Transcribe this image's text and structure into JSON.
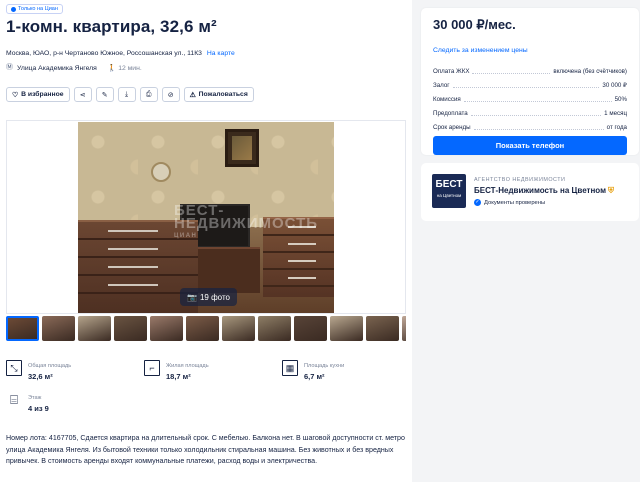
{
  "badge": "Только на Циан",
  "title": "1-комн. квартира, 32,6 м²",
  "address": {
    "text": "Москва, ЮАО, р-н Чертаново Южное, Россошанская ул., 11К3",
    "map_link": "На карте"
  },
  "metro": {
    "name": "Улица Академика Янгеля",
    "walk": "12 мин."
  },
  "actions": {
    "favorite": "В избранное",
    "report": "Пожаловаться",
    "icons": [
      "share-icon",
      "edit-icon",
      "download-icon",
      "print-icon",
      "hide-icon"
    ]
  },
  "gallery": {
    "photo_count": "19 фото",
    "watermark": "БЕСТ-НЕДВИЖИМОСТЬ",
    "watermark_small": "ЦИАН",
    "thumbnails": [
      "#6c4a36",
      "#8a6a58",
      "#b5a48c",
      "#6a5442",
      "#9a7a6a",
      "#7c5c48",
      "#a8987e",
      "#8e7e66",
      "#584438",
      "#b9a890",
      "#7a6450",
      "#c0a898"
    ]
  },
  "features": [
    {
      "label": "Общая площадь",
      "value": "32,6 м²",
      "icon": "total-area-icon"
    },
    {
      "label": "Жилая площадь",
      "value": "18,7 м²",
      "icon": "living-area-icon"
    },
    {
      "label": "Площадь кухни",
      "value": "6,7 м²",
      "icon": "kitchen-area-icon"
    },
    {
      "label": "Этаж",
      "value": "4 из 9",
      "icon": "floor-icon"
    }
  ],
  "description": "Номер лота: 4167705, Сдается квартира на длительный срок. С мебелью. Балкона нет. В шаговой доступности ст. метро улица Академика Янгеля. Из бытовой техники только холодильник стиральная машина. Без животных и без вредных привычек. В стоимость аренды входят коммунальные платежи, расход воды и электричества.",
  "price_card": {
    "price": "30 000 ₽/мес.",
    "watch_link": "Следить за изменением цены",
    "rows": [
      {
        "key": "Оплата ЖКХ",
        "value": "включена (без счётчиков)"
      },
      {
        "key": "Залог",
        "value": "30 000 ₽"
      },
      {
        "key": "Комиссия",
        "value": "50%"
      },
      {
        "key": "Предоплата",
        "value": "1 месяц"
      },
      {
        "key": "Срок аренды",
        "value": "от года"
      }
    ],
    "phone_button": "Показать телефон"
  },
  "agency": {
    "kind": "АГЕНТСТВО НЕДВИЖИМОСТИ",
    "name": "БЕСТ-Недвижимость на Цветном",
    "verified": "Документы проверены",
    "logo_line1": "БЕСТ",
    "logo_line2": "на Цветном"
  },
  "colors": {
    "accent": "#0468ff",
    "text": "#152242",
    "muted": "#7a8499"
  }
}
